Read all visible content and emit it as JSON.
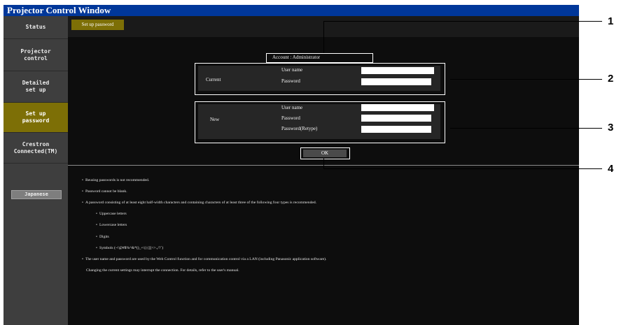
{
  "window": {
    "title": "Projector Control Window"
  },
  "sidebar": {
    "items": [
      {
        "label": "Status"
      },
      {
        "label": "Projector\ncontrol"
      },
      {
        "label": "Detailed\nset up"
      },
      {
        "label": "Set up\npassword",
        "active": true
      },
      {
        "label": "Crestron\nConnected(TM)"
      }
    ],
    "language_button": "Japanese"
  },
  "tab": {
    "label": "Set up password"
  },
  "account": {
    "label": "Account",
    "separator": ":",
    "value": "Administrator"
  },
  "current": {
    "section_label": "Current",
    "user_name_label": "User name",
    "password_label": "Password",
    "user_name_value": "",
    "password_value": ""
  },
  "new": {
    "section_label": "New",
    "user_name_label": "User name",
    "password_label": "Password",
    "retype_label": "Password(Retype)",
    "user_name_value": "",
    "password_value": "",
    "retype_value": ""
  },
  "ok_label": "OK",
  "notes": {
    "n1": "Reusing passwords is not recommended.",
    "n2": "Password cannot be blank.",
    "n3": "A password consisting of at least eight half-width characters and containing characters of at least three of the following four types is recommended.",
    "t1": "Uppercase letters",
    "t2": "Lowercase letters",
    "t3": "Digits",
    "t4": "Symbols (~!@#$%^&*()_+\\|}{][<>.,/?`)",
    "n4": "The user name and password are used by the Web Control function and for communication control via a LAN (including Panasonic application software).",
    "n5": "Changing the current settings may interrupt the connection. For details, refer to the user's manual."
  },
  "callouts": {
    "c1": "1",
    "c2": "2",
    "c3": "3",
    "c4": "4"
  },
  "colors": {
    "title_bar": "#00379a",
    "active": "#7d6f06",
    "sidebar": "#3e3e3e",
    "content": "#0d0d0d"
  },
  "bullet_glyph": "•"
}
